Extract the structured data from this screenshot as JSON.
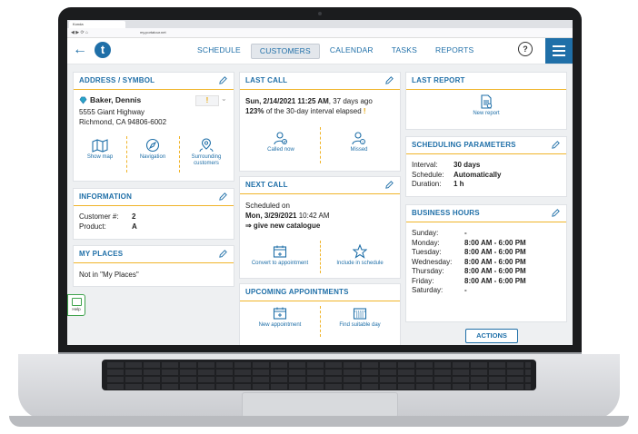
{
  "browser": {
    "tab_title": "Konda",
    "url": "my.portatour.net"
  },
  "header": {
    "nav": [
      "SCHEDULE",
      "CUSTOMERS",
      "CALENDAR",
      "TASKS",
      "REPORTS"
    ],
    "active_nav": "CUSTOMERS",
    "help_label": "?"
  },
  "address": {
    "title": "ADDRESS / SYMBOL",
    "name": "Baker, Dennis",
    "priority": "!",
    "street": "5555 Giant Highway",
    "city": "Richmond, CA 94806-6002",
    "actions": [
      "Show map",
      "Navigation",
      "Surrounding customers"
    ]
  },
  "information": {
    "title": "INFORMATION",
    "rows": [
      {
        "label": "Customer #:",
        "value": "2"
      },
      {
        "label": "Product:",
        "value": "A"
      }
    ]
  },
  "places": {
    "title": "MY PLACES",
    "text": "Not in \"My Places\""
  },
  "last_call": {
    "title": "LAST CALL",
    "date": "Sun, 2/14/2021 11:25 AM",
    "date_suffix": ", 37 days ago",
    "interval_pct": "123%",
    "interval_text": " of the 30-day interval elapsed ",
    "warn": "!",
    "actions": [
      "Called now",
      "Missed"
    ]
  },
  "next_call": {
    "title": "NEXT CALL",
    "line1": "Scheduled on",
    "date": "Mon, 3/29/2021",
    "time": " 10:42 AM",
    "note": "⇒ give new catalogue",
    "actions": [
      "Convert to appointment",
      "Include in schedule"
    ]
  },
  "upcoming": {
    "title": "UPCOMING APPOINTMENTS",
    "actions": [
      "New appointment",
      "Find suitable day"
    ]
  },
  "last_report": {
    "title": "LAST REPORT",
    "action": "New report"
  },
  "scheduling": {
    "title": "SCHEDULING PARAMETERS",
    "rows": [
      {
        "label": "Interval:",
        "value": "30 days"
      },
      {
        "label": "Schedule:",
        "value": "Automatically"
      },
      {
        "label": "Duration:",
        "value": "1 h"
      }
    ]
  },
  "hours": {
    "title": "BUSINESS HOURS",
    "rows": [
      {
        "label": "Sunday:",
        "value": "-"
      },
      {
        "label": "Monday:",
        "value": "8:00 AM - 6:00 PM"
      },
      {
        "label": "Tuesday:",
        "value": "8:00 AM - 6:00 PM"
      },
      {
        "label": "Wednesday:",
        "value": "8:00 AM - 6:00 PM"
      },
      {
        "label": "Thursday:",
        "value": "8:00 AM - 6:00 PM"
      },
      {
        "label": "Friday:",
        "value": "8:00 AM - 6:00 PM"
      },
      {
        "label": "Saturday:",
        "value": "-"
      }
    ]
  },
  "help_float": "Help",
  "actions_button": "ACTIONS",
  "colors": {
    "accent": "#1f6fa8",
    "divider": "#f0b429",
    "background": "#eef0f2"
  }
}
